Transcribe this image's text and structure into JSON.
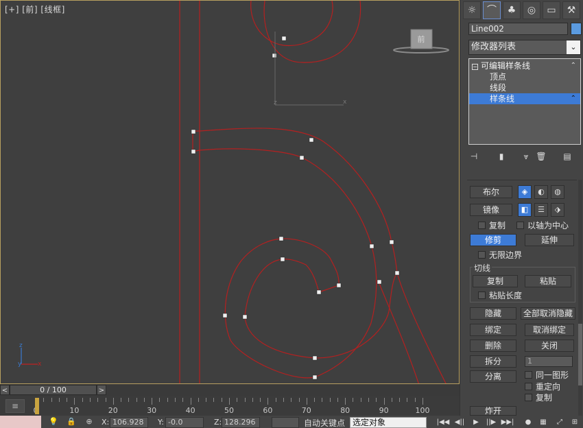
{
  "viewport": {
    "label": "[+] [前] [线框]",
    "gizmo_label": "前",
    "axis_small": {
      "z": "z",
      "x": "x"
    },
    "axis_corner": {
      "z": "z",
      "y": "y",
      "x": "x"
    }
  },
  "timeline": {
    "frame_display": "0 / 100",
    "prev": "<",
    "next": ">",
    "ruler_labels": [
      "0",
      "10",
      "20",
      "30",
      "40",
      "50",
      "60",
      "70",
      "80",
      "90",
      "100"
    ]
  },
  "statusbar": {
    "x_label": "X:",
    "x_value": "106.928",
    "y_label": "Y:",
    "y_value": "-0.0",
    "z_label": "Z:",
    "z_value": "128.296",
    "autokey_label": "自动关键点",
    "select_mode": "选定对象"
  },
  "cmdpanel": {
    "object_name": "Line002",
    "object_color": "#5b9be0",
    "modifier_list": "修改器列表",
    "stack": {
      "root": "可编辑样条线",
      "items": [
        "顶点",
        "线段",
        "样条线"
      ],
      "selected": "样条线"
    },
    "rollout": {
      "boolean": "布尔",
      "mirror": "镜像",
      "copy": "复制",
      "about_pivot": "以轴为中心",
      "trim": "修剪",
      "extend": "延伸",
      "infinite_bounds": "无限边界",
      "tangent_group": "切线",
      "tangent_copy": "复制",
      "tangent_paste": "粘贴",
      "paste_length": "粘贴长度",
      "hide": "隐藏",
      "unhide_all": "全部取消隐藏",
      "bind": "绑定",
      "unbind": "取消绑定",
      "delete": "删除",
      "close": "关闭",
      "divide": "拆分",
      "divide_value": "1",
      "detach": "分离",
      "same_shape": "同一图形",
      "reorient": "重定向",
      "detach_copy": "复制",
      "explode_partial": "炸开"
    }
  }
}
